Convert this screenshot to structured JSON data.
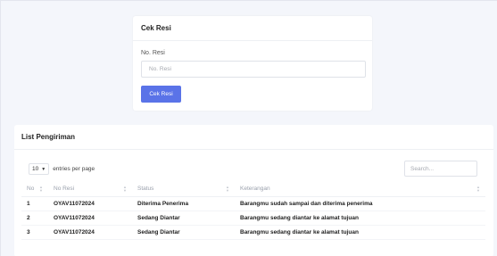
{
  "cek_resi": {
    "title": "Cek Resi",
    "field_label": "No. Resi",
    "input_placeholder": "No. Resi",
    "input_value": "",
    "button_label": "Cek Resi",
    "button_color": "#5a73e8"
  },
  "list": {
    "title": "List Pengiriman",
    "entries_value": "10",
    "entries_suffix": "entries per page",
    "search_placeholder": "Search...",
    "columns": [
      "No",
      "No Resi",
      "Status",
      "Keterangan"
    ],
    "rows": [
      {
        "no": "1",
        "resi": "OYAV11072024",
        "status": "Diterima Penerima",
        "keterangan": "Barangmu sudah sampai dan diterima penerima"
      },
      {
        "no": "2",
        "resi": "OYAV11072024",
        "status": "Sedang Diantar",
        "keterangan": "Barangmu sedang diantar ke alamat tujuan"
      },
      {
        "no": "3",
        "resi": "OYAV11072024",
        "status": "Sedang Diantar",
        "keterangan": "Barangmu sedang diantar ke alamat tujuan"
      }
    ]
  }
}
